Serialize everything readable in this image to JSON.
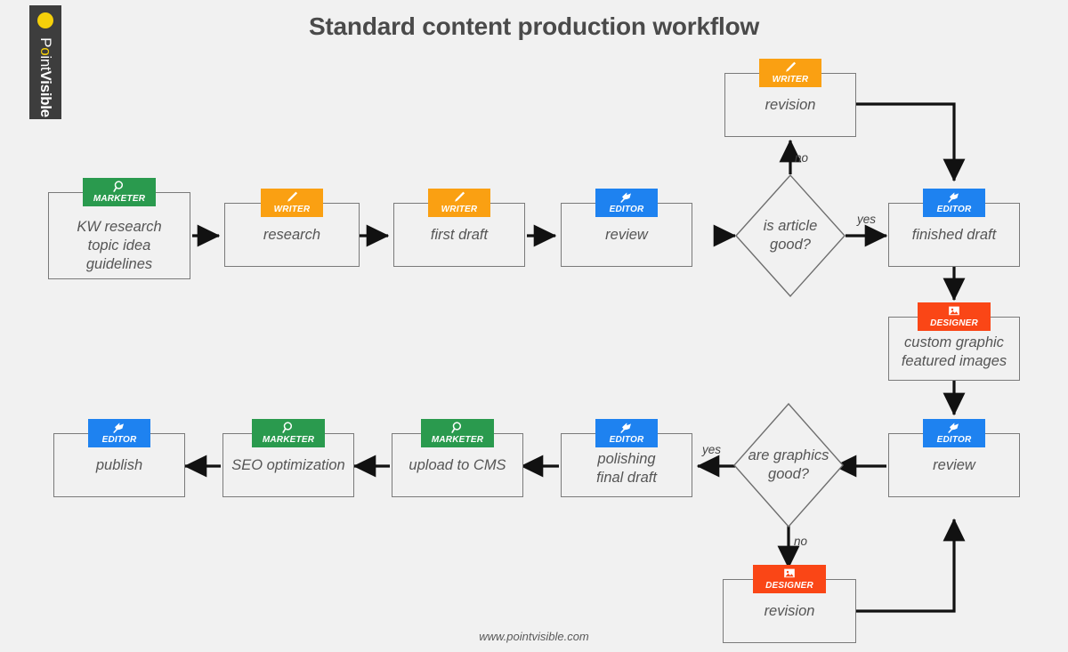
{
  "page": {
    "title": "Standard content production workflow",
    "footer": "www.pointvisible.com",
    "background": "#f1f1f1"
  },
  "logo": {
    "name": "PointVisible",
    "part1": "P",
    "part2": "o",
    "part3": "int",
    "part4": "V",
    "part5": "isible",
    "dot_color": "#f5d00a",
    "bar_color": "#3d3d3d"
  },
  "roles": {
    "marketer": {
      "label": "MARKETER",
      "color": "#2a9a4e",
      "icon": "magnifier-icon"
    },
    "writer": {
      "label": "WRITER",
      "color": "#faa012",
      "icon": "pen-icon"
    },
    "editor": {
      "label": "EDITOR",
      "color": "#1e82f0",
      "icon": "pushpin-icon"
    },
    "designer": {
      "label": "DESIGNER",
      "color": "#fa4616",
      "icon": "image-icon"
    }
  },
  "nodes": [
    {
      "id": "kw_research",
      "role": "MARKETER",
      "lines": [
        "KW research",
        "topic idea",
        "guidelines"
      ]
    },
    {
      "id": "research",
      "role": "WRITER",
      "lines": [
        "research"
      ]
    },
    {
      "id": "first_draft",
      "role": "WRITER",
      "lines": [
        "first draft"
      ]
    },
    {
      "id": "review_top",
      "role": "EDITOR",
      "lines": [
        "review"
      ]
    },
    {
      "id": "revision_top",
      "role": "WRITER",
      "lines": [
        "revision"
      ]
    },
    {
      "id": "finished_draft",
      "role": "EDITOR",
      "lines": [
        "finished draft"
      ]
    },
    {
      "id": "custom_graphic",
      "role": "DESIGNER",
      "lines": [
        "custom graphic",
        "featured images"
      ]
    },
    {
      "id": "review_bottom",
      "role": "EDITOR",
      "lines": [
        "review"
      ]
    },
    {
      "id": "revision_bottom",
      "role": "DESIGNER",
      "lines": [
        "revision"
      ]
    },
    {
      "id": "polishing",
      "role": "EDITOR",
      "lines": [
        "polishing",
        "final draft"
      ]
    },
    {
      "id": "upload_cms",
      "role": "MARKETER",
      "lines": [
        "upload to CMS"
      ]
    },
    {
      "id": "seo",
      "role": "MARKETER",
      "lines": [
        "SEO optimization"
      ]
    },
    {
      "id": "publish",
      "role": "EDITOR",
      "lines": [
        "publish"
      ]
    }
  ],
  "decisions": [
    {
      "id": "is_article_good",
      "lines": [
        "is article",
        "good?"
      ]
    },
    {
      "id": "are_graphics_good",
      "lines": [
        "are graphics",
        "good?"
      ]
    }
  ],
  "edge_labels": {
    "article_no": "no",
    "article_yes": "yes",
    "graphics_yes": "yes",
    "graphics_no": "no"
  }
}
